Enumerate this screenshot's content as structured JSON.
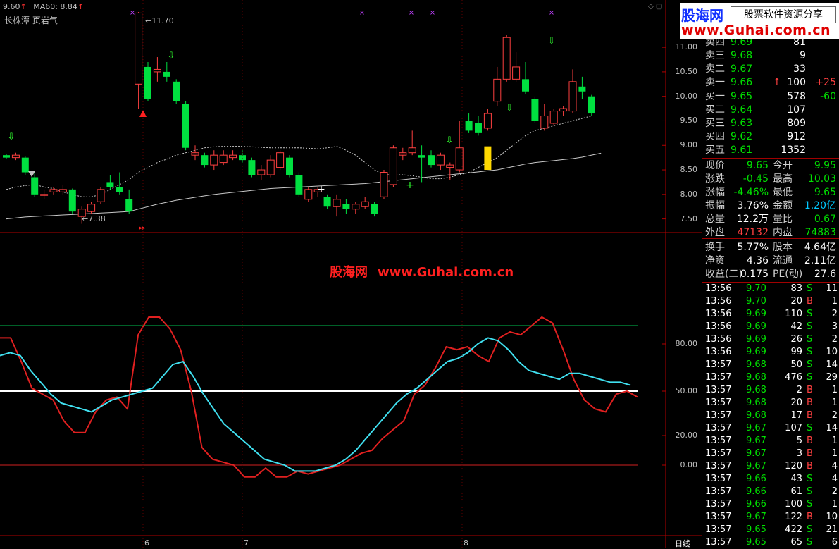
{
  "header": {
    "price_label": "9.60",
    "ma_label": "MA60: 8.84",
    "stock_name": "长株潭 页岩气",
    "high_marker": "11.70",
    "low_marker": "7.38"
  },
  "logo": {
    "brand": "股海网",
    "slogan": "股票软件资源分享",
    "url": "www.Guhai.com.cn"
  },
  "watermark": {
    "text1": "股海网",
    "text2": "www.Guhai.com.cn"
  },
  "price_axis": [
    "11.00",
    "10.50",
    "10.00",
    "9.50",
    "9.00",
    "8.50",
    "8.00",
    "7.50"
  ],
  "indicator_axis": [
    "80.00",
    "50.00",
    "20.00",
    "0.00"
  ],
  "x_axis": [
    "6",
    "7",
    "8"
  ],
  "period_label": "日线",
  "order_book": {
    "asks": [
      {
        "label": "卖四",
        "price": "9.69",
        "vol": "81",
        "chg": ""
      },
      {
        "label": "卖三",
        "price": "9.68",
        "vol": "9",
        "chg": ""
      },
      {
        "label": "卖二",
        "price": "9.67",
        "vol": "33",
        "chg": ""
      },
      {
        "label": "卖一",
        "price": "9.66",
        "vol": "100",
        "chg": "+25",
        "arrow": "↑"
      }
    ],
    "bids": [
      {
        "label": "买一",
        "price": "9.65",
        "vol": "578",
        "chg": "-60"
      },
      {
        "label": "买二",
        "price": "9.64",
        "vol": "107",
        "chg": ""
      },
      {
        "label": "买三",
        "price": "9.63",
        "vol": "809",
        "chg": ""
      },
      {
        "label": "买四",
        "price": "9.62",
        "vol": "912",
        "chg": ""
      },
      {
        "label": "买五",
        "price": "9.61",
        "vol": "1352",
        "chg": ""
      }
    ]
  },
  "quote": {
    "xianjia_label": "现价",
    "xianjia": "9.65",
    "jinkai_label": "今开",
    "jinkai": "9.95",
    "zhangdie_label": "涨跌",
    "zhangdie": "-0.45",
    "zuigao_label": "最高",
    "zuigao": "10.03",
    "zhangfu_label": "涨幅",
    "zhangfu": "-4.46%",
    "zuidi_label": "最低",
    "zuidi": "9.65",
    "zhenfu_label": "振幅",
    "zhenfu": "3.76%",
    "jine_label": "金额",
    "jine": "1.20亿",
    "zongliang_label": "总量",
    "zongliang": "12.2万",
    "liangbi_label": "量比",
    "liangbi": "0.67",
    "waipan_label": "外盘",
    "waipan": "47132",
    "neipan_label": "内盘",
    "neipan": "74883",
    "huanshou_label": "换手",
    "huanshou": "5.77%",
    "guben_label": "股本",
    "guben": "4.64亿",
    "jingzi_label": "净资",
    "jingzi": "4.36",
    "liutong_label": "流通",
    "liutong": "2.11亿",
    "shouyi_label": "收益(二)",
    "shouyi": "0.175",
    "pe_label": "PE(动)",
    "pe": "27.6"
  },
  "ticks": [
    {
      "time": "13:56",
      "price": "9.70",
      "vol": "83",
      "side": "S",
      "n": "11"
    },
    {
      "time": "13:56",
      "price": "9.70",
      "vol": "20",
      "side": "B",
      "n": "1"
    },
    {
      "time": "13:56",
      "price": "9.69",
      "vol": "110",
      "side": "S",
      "n": "2"
    },
    {
      "time": "13:56",
      "price": "9.69",
      "vol": "42",
      "side": "S",
      "n": "3"
    },
    {
      "time": "13:56",
      "price": "9.69",
      "vol": "26",
      "side": "S",
      "n": "2"
    },
    {
      "time": "13:56",
      "price": "9.69",
      "vol": "99",
      "side": "S",
      "n": "10"
    },
    {
      "time": "13:57",
      "price": "9.68",
      "vol": "50",
      "side": "S",
      "n": "14"
    },
    {
      "time": "13:57",
      "price": "9.68",
      "vol": "476",
      "side": "S",
      "n": "29"
    },
    {
      "time": "13:57",
      "price": "9.68",
      "vol": "2",
      "side": "B",
      "n": "1"
    },
    {
      "time": "13:57",
      "price": "9.68",
      "vol": "20",
      "side": "B",
      "n": "1"
    },
    {
      "time": "13:57",
      "price": "9.68",
      "vol": "17",
      "side": "B",
      "n": "2"
    },
    {
      "time": "13:57",
      "price": "9.67",
      "vol": "107",
      "side": "S",
      "n": "14"
    },
    {
      "time": "13:57",
      "price": "9.67",
      "vol": "5",
      "side": "B",
      "n": "1"
    },
    {
      "time": "13:57",
      "price": "9.67",
      "vol": "3",
      "side": "B",
      "n": "1"
    },
    {
      "time": "13:57",
      "price": "9.67",
      "vol": "120",
      "side": "B",
      "n": "4"
    },
    {
      "time": "13:57",
      "price": "9.66",
      "vol": "43",
      "side": "S",
      "n": "4"
    },
    {
      "time": "13:57",
      "price": "9.66",
      "vol": "61",
      "side": "S",
      "n": "2"
    },
    {
      "time": "13:57",
      "price": "9.66",
      "vol": "100",
      "side": "S",
      "n": "1"
    },
    {
      "time": "13:57",
      "price": "9.67",
      "vol": "122",
      "side": "B",
      "n": "10"
    },
    {
      "time": "13:57",
      "price": "9.65",
      "vol": "422",
      "side": "S",
      "n": "21"
    },
    {
      "time": "13:57",
      "price": "9.65",
      "vol": "65",
      "side": "S",
      "n": "6"
    }
  ],
  "chart_data": {
    "type": "candlestick",
    "ylim": [
      7.25,
      11.85
    ],
    "candles": [
      {
        "o": 8.8,
        "c": 8.75,
        "h": 8.82,
        "l": 8.72
      },
      {
        "o": 8.75,
        "c": 8.8,
        "h": 8.85,
        "l": 8.7
      },
      {
        "o": 8.75,
        "c": 8.45,
        "h": 8.78,
        "l": 8.4
      },
      {
        "o": 8.35,
        "c": 8.0,
        "h": 8.45,
        "l": 7.95
      },
      {
        "o": 7.98,
        "c": 8.0,
        "h": 8.1,
        "l": 7.9
      },
      {
        "o": 8.05,
        "c": 8.1,
        "h": 8.15,
        "l": 8.0
      },
      {
        "o": 8.05,
        "c": 8.1,
        "h": 8.2,
        "l": 8.0
      },
      {
        "o": 8.1,
        "c": 7.65,
        "h": 8.12,
        "l": 7.6
      },
      {
        "o": 7.55,
        "c": 7.7,
        "h": 7.75,
        "l": 7.4
      },
      {
        "o": 7.65,
        "c": 7.8,
        "h": 7.85,
        "l": 7.6
      },
      {
        "o": 7.85,
        "c": 8.1,
        "h": 8.15,
        "l": 7.8
      },
      {
        "o": 8.25,
        "c": 8.15,
        "h": 8.4,
        "l": 8.1
      },
      {
        "o": 8.15,
        "c": 8.05,
        "h": 8.45,
        "l": 8.0
      },
      {
        "o": 7.9,
        "c": 7.65,
        "h": 8.1,
        "l": 7.6
      },
      {
        "o": 10.25,
        "c": 11.7,
        "h": 11.72,
        "l": 9.75
      },
      {
        "o": 10.6,
        "c": 9.95,
        "h": 10.7,
        "l": 9.9
      },
      {
        "o": 10.5,
        "c": 10.55,
        "h": 10.8,
        "l": 10.3
      },
      {
        "o": 10.5,
        "c": 10.4,
        "h": 10.7,
        "l": 10.3
      },
      {
        "o": 10.3,
        "c": 9.9,
        "h": 10.35,
        "l": 9.85
      },
      {
        "o": 9.85,
        "c": 8.95,
        "h": 9.9,
        "l": 8.9
      },
      {
        "o": 8.8,
        "c": 8.85,
        "h": 9.0,
        "l": 8.7
      },
      {
        "o": 8.8,
        "c": 8.6,
        "h": 8.85,
        "l": 8.55
      },
      {
        "o": 8.6,
        "c": 8.8,
        "h": 8.9,
        "l": 8.5
      },
      {
        "o": 8.65,
        "c": 8.8,
        "h": 8.9,
        "l": 8.6
      },
      {
        "o": 8.75,
        "c": 8.8,
        "h": 8.9,
        "l": 8.7
      },
      {
        "o": 8.8,
        "c": 8.7,
        "h": 8.9,
        "l": 8.65
      },
      {
        "o": 8.7,
        "c": 8.4,
        "h": 8.75,
        "l": 8.35
      },
      {
        "o": 8.4,
        "c": 8.5,
        "h": 8.6,
        "l": 8.3
      },
      {
        "o": 8.4,
        "c": 8.7,
        "h": 8.8,
        "l": 8.35
      },
      {
        "o": 8.55,
        "c": 8.85,
        "h": 8.9,
        "l": 8.5
      },
      {
        "o": 8.75,
        "c": 8.4,
        "h": 8.8,
        "l": 8.35
      },
      {
        "o": 8.4,
        "c": 8.0,
        "h": 8.45,
        "l": 7.95
      },
      {
        "o": 7.9,
        "c": 8.1,
        "h": 8.15,
        "l": 7.85
      },
      {
        "o": 8.05,
        "c": 8.1,
        "h": 8.15,
        "l": 7.95
      },
      {
        "o": 7.95,
        "c": 7.75,
        "h": 8.0,
        "l": 7.7
      },
      {
        "o": 7.75,
        "c": 7.9,
        "h": 8.0,
        "l": 7.55
      },
      {
        "o": 7.8,
        "c": 7.7,
        "h": 7.9,
        "l": 7.6
      },
      {
        "o": 7.7,
        "c": 7.8,
        "h": 7.85,
        "l": 7.6
      },
      {
        "o": 7.75,
        "c": 7.85,
        "h": 7.95,
        "l": 7.7
      },
      {
        "o": 7.8,
        "c": 7.6,
        "h": 7.85,
        "l": 7.55
      },
      {
        "o": 7.95,
        "c": 8.45,
        "h": 8.5,
        "l": 7.9
      },
      {
        "o": 8.2,
        "c": 8.95,
        "h": 9.0,
        "l": 8.15
      },
      {
        "o": 8.8,
        "c": 8.85,
        "h": 8.95,
        "l": 8.7
      },
      {
        "o": 8.85,
        "c": 8.95,
        "h": 9.3,
        "l": 8.8
      },
      {
        "o": 8.8,
        "c": 8.75,
        "h": 9.0,
        "l": 8.25
      },
      {
        "o": 8.8,
        "c": 8.6,
        "h": 8.9,
        "l": 8.55
      },
      {
        "o": 8.6,
        "c": 8.8,
        "h": 8.85,
        "l": 8.5
      },
      {
        "o": 8.55,
        "c": 8.6,
        "h": 8.65,
        "l": 8.3
      },
      {
        "o": 8.5,
        "c": 8.95,
        "h": 9.5,
        "l": 8.45
      },
      {
        "o": 9.5,
        "c": 9.3,
        "h": 9.65,
        "l": 9.25
      },
      {
        "o": 9.45,
        "c": 9.25,
        "h": 9.6,
        "l": 9.2
      },
      {
        "o": 9.35,
        "c": 9.65,
        "h": 9.75,
        "l": 9.3
      },
      {
        "o": 9.9,
        "c": 10.35,
        "h": 10.6,
        "l": 9.8
      },
      {
        "o": 10.35,
        "c": 11.2,
        "h": 11.25,
        "l": 10.3
      },
      {
        "o": 10.35,
        "c": 10.6,
        "h": 10.9,
        "l": 10.3
      },
      {
        "o": 10.35,
        "c": 10.1,
        "h": 10.7,
        "l": 10.05
      },
      {
        "o": 9.95,
        "c": 9.5,
        "h": 10.0,
        "l": 9.45
      },
      {
        "o": 9.35,
        "c": 9.6,
        "h": 9.85,
        "l": 9.3
      },
      {
        "o": 9.45,
        "c": 9.7,
        "h": 9.75,
        "l": 9.4
      },
      {
        "o": 9.7,
        "c": 9.75,
        "h": 9.8,
        "l": 9.6
      },
      {
        "o": 9.7,
        "c": 10.3,
        "h": 10.55,
        "l": 9.65
      },
      {
        "o": 10.2,
        "c": 10.1,
        "h": 10.4,
        "l": 9.95
      },
      {
        "o": 10.0,
        "c": 9.65,
        "h": 10.03,
        "l": 9.6
      }
    ],
    "ma_long": [
      7.5,
      7.52,
      7.54,
      7.55,
      7.56,
      7.57,
      7.58,
      7.59,
      7.6,
      7.61,
      7.62,
      7.63,
      7.64,
      7.65,
      7.7,
      7.75,
      7.8,
      7.84,
      7.88,
      7.91,
      7.94,
      7.97,
      8.0,
      8.02,
      8.04,
      8.06,
      8.08,
      8.1,
      8.12,
      8.13,
      8.14,
      8.15,
      8.16,
      8.17,
      8.18,
      8.19,
      8.2,
      8.21,
      8.22,
      8.24,
      8.26,
      8.28,
      8.3,
      8.32,
      8.34,
      8.36,
      8.38,
      8.4,
      8.42,
      8.44,
      8.46,
      8.48,
      8.5,
      8.54,
      8.58,
      8.62,
      8.65,
      8.67,
      8.69,
      8.71,
      8.73,
      8.76,
      8.8,
      8.84
    ],
    "ma_short": [
      8.1,
      8.15,
      8.18,
      8.2,
      8.15,
      8.12,
      8.05,
      8.0,
      7.95,
      7.95,
      8.0,
      8.1,
      8.2,
      8.3,
      8.45,
      8.55,
      8.65,
      8.72,
      8.8,
      8.85,
      8.9,
      8.95,
      8.97,
      8.98,
      8.98,
      8.98,
      8.97,
      8.96,
      8.95,
      8.95,
      8.95,
      8.95,
      8.94,
      8.93,
      8.95,
      8.98,
      8.9,
      8.8,
      8.65,
      8.5,
      8.4,
      8.4,
      8.4,
      8.38,
      8.35,
      8.32,
      8.32,
      8.35,
      8.4,
      8.45,
      8.55,
      8.65,
      8.75,
      8.9,
      9.05,
      9.2,
      9.3,
      9.35,
      9.4,
      9.45,
      9.5,
      9.55,
      9.6
    ],
    "k_line": [
      86,
      86,
      70,
      52,
      48,
      44,
      30,
      22,
      22,
      36,
      44,
      46,
      38,
      88,
      100,
      100,
      92,
      78,
      50,
      12,
      4,
      2,
      0,
      -8,
      -8,
      -2,
      -8,
      -8,
      -4,
      -6,
      -4,
      -2,
      0,
      4,
      8,
      10,
      18,
      24,
      30,
      48,
      54,
      66,
      80,
      78,
      80,
      74,
      70,
      86,
      90,
      88,
      94,
      100,
      96,
      78,
      58,
      44,
      38,
      36,
      48,
      50,
      46
    ],
    "d_line": [
      74,
      76,
      74,
      64,
      56,
      48,
      42,
      40,
      38,
      36,
      40,
      44,
      46,
      48,
      50,
      52,
      60,
      68,
      70,
      60,
      48,
      38,
      28,
      22,
      16,
      10,
      4,
      2,
      0,
      -4,
      -4,
      -4,
      -2,
      0,
      4,
      10,
      18,
      26,
      34,
      42,
      48,
      52,
      58,
      64,
      70,
      72,
      76,
      82,
      86,
      84,
      78,
      70,
      64,
      62,
      60,
      58,
      62,
      62,
      60,
      58,
      56,
      56,
      54
    ],
    "overbought": 80,
    "middle": 50,
    "oversold": 0
  }
}
